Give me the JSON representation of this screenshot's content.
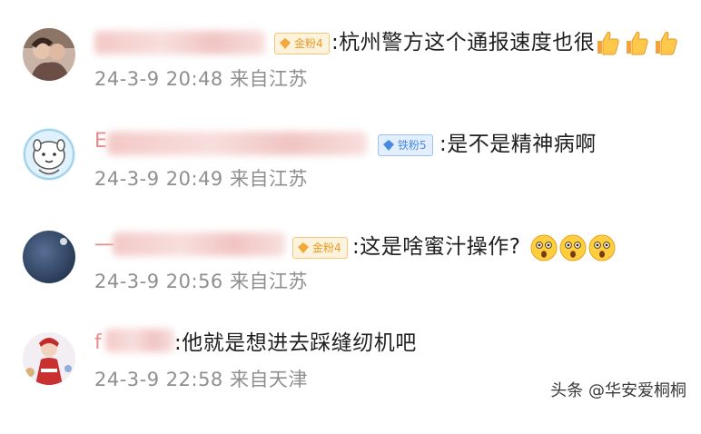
{
  "comments": [
    {
      "badge": "金粉4",
      "text": ":杭州警方这个通报速度也很",
      "time": "24-3-9 20:48",
      "location": "来自江苏"
    },
    {
      "name_visible": "E",
      "badge": "铁粉5",
      "text": ":是不是精神病啊",
      "time": "24-3-9 20:49",
      "location": "来自江苏"
    },
    {
      "name_visible": "一",
      "badge": "金粉4",
      "text": ":这是啥蜜汁操作?",
      "time": "24-3-9 20:56",
      "location": "来自江苏"
    },
    {
      "name_visible": "f",
      "text": ":他就是想进去踩缝纫机吧",
      "time": "24-3-9 22:58",
      "location": "来自天津"
    }
  ],
  "icons": {
    "thumbs": "thumbs-up-icon",
    "shocked": "shocked-face-icon"
  },
  "colors": {
    "gold_badge": "#e59b26",
    "blue_badge": "#4a8ae0",
    "meta": "#8f8f8f",
    "text": "#1f1f1f"
  },
  "watermark": "头条 @华安爱桐桐"
}
